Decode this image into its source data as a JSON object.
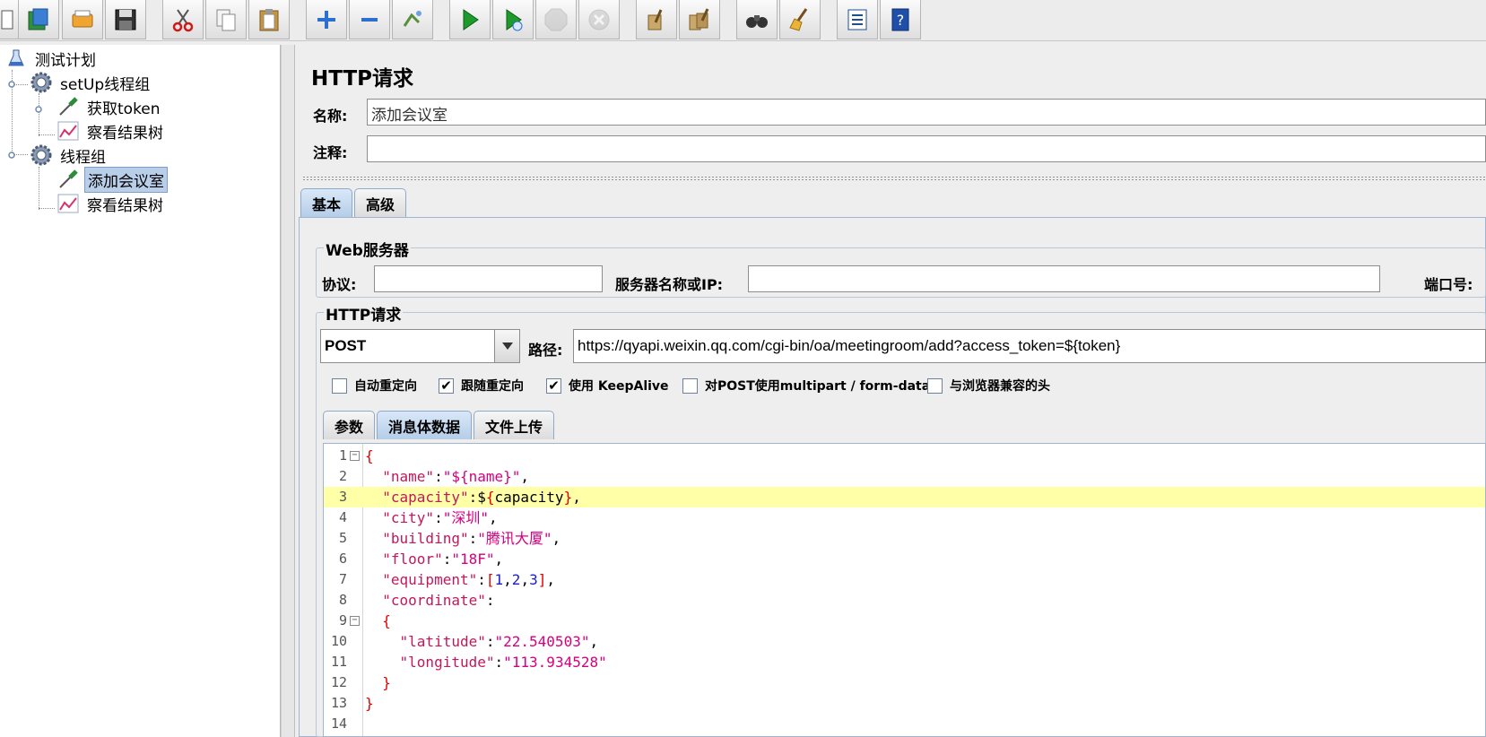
{
  "toolbar": {
    "buttons": [
      "new-icon",
      "templates-icon",
      "open-icon",
      "save-icon",
      "cut-icon",
      "copy-icon",
      "paste-icon",
      "expand-icon",
      "collapse-icon",
      "toggle-icon",
      "start-icon",
      "start-no-pause-icon",
      "stop-icon",
      "shutdown-icon",
      "clear-icon",
      "clear-all-icon",
      "search-icon",
      "reset-search-icon",
      "function-helper-icon",
      "help-icon"
    ]
  },
  "tree": {
    "items": [
      {
        "label": "测试计划"
      },
      {
        "label": "setUp线程组"
      },
      {
        "label": "获取token"
      },
      {
        "label": "察看结果树"
      },
      {
        "label": "线程组"
      },
      {
        "label": "添加会议室"
      },
      {
        "label": "察看结果树"
      }
    ]
  },
  "panel": {
    "title": "HTTP请求",
    "name_label": "名称:",
    "name_value": "添加会议室",
    "comment_label": "注释:",
    "comment_value": "",
    "tabs": [
      "基本",
      "高级"
    ],
    "web_server": {
      "title": "Web服务器",
      "protocol_label": "协议:",
      "protocol_value": "",
      "server_label": "服务器名称或IP:",
      "server_value": "",
      "port_label": "端口号:"
    },
    "http": {
      "title": "HTTP请求",
      "method": "POST",
      "path_label": "路径:",
      "path_value": "https://qyapi.weixin.qq.com/cgi-bin/oa/meetingroom/add?access_token=${token}",
      "options": [
        {
          "label": "自动重定向",
          "checked": false
        },
        {
          "label": "跟随重定向",
          "checked": true
        },
        {
          "label": "使用 KeepAlive",
          "checked": true
        },
        {
          "label": "对POST使用multipart / form-data",
          "checked": false
        },
        {
          "label": "与浏览器兼容的头",
          "checked": false
        }
      ],
      "subtabs": [
        "参数",
        "消息体数据",
        "文件上传"
      ]
    },
    "body_lines": [
      "1",
      "2",
      "3",
      "4",
      "5",
      "6",
      "7",
      "8",
      "9",
      "10",
      "11",
      "12",
      "13",
      "14"
    ],
    "body": {
      "l1": "{",
      "name_key": "\"name\"",
      "name_val": "\"${name}\"",
      "capacity_key": "\"capacity\"",
      "capacity_val": "capacity",
      "city_key": "\"city\"",
      "city_val": "\"深圳\"",
      "building_key": "\"building\"",
      "building_val": "\"腾讯大厦\"",
      "floor_key": "\"floor\"",
      "floor_val": "\"18F\"",
      "equipment_key": "\"equipment\"",
      "eq1": "1",
      "eq2": "2",
      "eq3": "3",
      "coordinate_key": "\"coordinate\"",
      "latitude_key": "\"latitude\"",
      "latitude_val": "\"22.540503\"",
      "longitude_key": "\"longitude\"",
      "longitude_val": "\"113.934528\""
    }
  }
}
